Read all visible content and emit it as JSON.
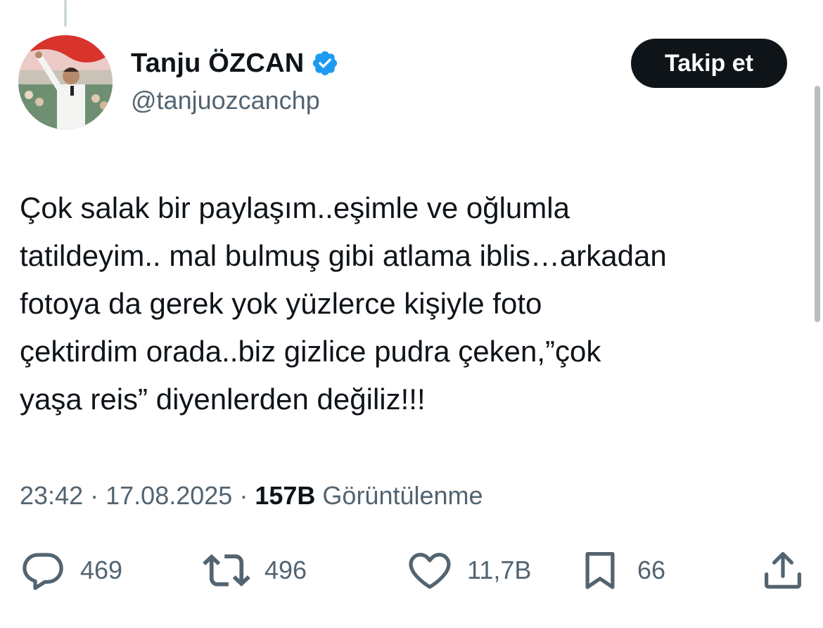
{
  "tweet": {
    "author": {
      "display_name": "Tanju ÖZCAN",
      "handle": "@tanjuozcanchp",
      "verified": true,
      "avatar_icon": "profile-photo"
    },
    "follow_label": "Takip et",
    "text_lines": [
      "Çok salak bir paylaşım..eşimle ve oğlumla",
      "tatildeyim.. mal bulmuş gibi atlama iblis…arkadan",
      "fotoya da gerek yok yüzlerce kişiyle foto",
      "çektirdim orada..biz gizlice pudra çeken,”çok",
      "yaşa reis” diyenlerden değiliz!!!"
    ],
    "meta": {
      "time": "23:42",
      "separator": "·",
      "date": "17.08.2025",
      "views_count": "157B",
      "views_label": "Görüntülenme"
    },
    "actions": {
      "reply_count": "469",
      "retweet_count": "496",
      "like_count": "11,7B",
      "bookmark_count": "66"
    }
  },
  "colors": {
    "text_primary": "#0f1419",
    "text_secondary": "#536471",
    "verified_blue": "#1d9bf0",
    "button_bg": "#0f1419",
    "button_text": "#ffffff"
  }
}
